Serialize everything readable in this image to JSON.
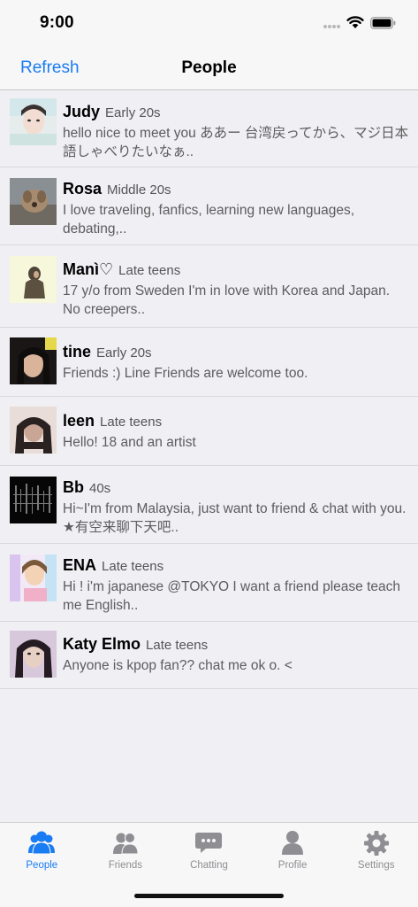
{
  "status_bar": {
    "time": "9:00"
  },
  "nav": {
    "left_button": "Refresh",
    "title": "People"
  },
  "people": [
    {
      "name": "Judy",
      "age": "Early 20s",
      "message": "hello nice to meet you ああー 台湾戻ってから、マジ日本語しゃべりたいなぁ.."
    },
    {
      "name": "Rosa",
      "age": "Middle 20s",
      "message": "I love traveling, fanfics, learning new languages, debating,.."
    },
    {
      "name": "Manì♡",
      "age": "Late teens",
      "message": "17 y/o from Sweden I'm in love with Korea and Japan. No creepers.."
    },
    {
      "name": "tine",
      "age": "Early 20s",
      "message": "Friends :) Line Friends are welcome too."
    },
    {
      "name": "leen",
      "age": "Late teens",
      "message": "Hello! 18 and an artist"
    },
    {
      "name": "Bb",
      "age": "40s",
      "message": "Hi~I'm from Malaysia, just want to friend & chat with you. ★有空来聊下天吧.."
    },
    {
      "name": "ENA",
      "age": "Late teens",
      "message": "Hi ! i'm japanese @TOKYO I want a friend please teach me English.."
    },
    {
      "name": "Katy Elmo",
      "age": "Late teens",
      "message": "Anyone is kpop fan?? chat me ok o. <"
    }
  ],
  "tabs": [
    {
      "label": "People",
      "icon": "people-icon",
      "active": true
    },
    {
      "label": "Friends",
      "icon": "friends-icon",
      "active": false
    },
    {
      "label": "Chatting",
      "icon": "chat-bubble-icon",
      "active": false
    },
    {
      "label": "Profile",
      "icon": "profile-icon",
      "active": false
    },
    {
      "label": "Settings",
      "icon": "gear-icon",
      "active": false
    }
  ],
  "colors": {
    "accent": "#1a7cf2",
    "inactive": "#8e8e93",
    "background": "#efeff4",
    "bar": "#f7f7f7"
  }
}
